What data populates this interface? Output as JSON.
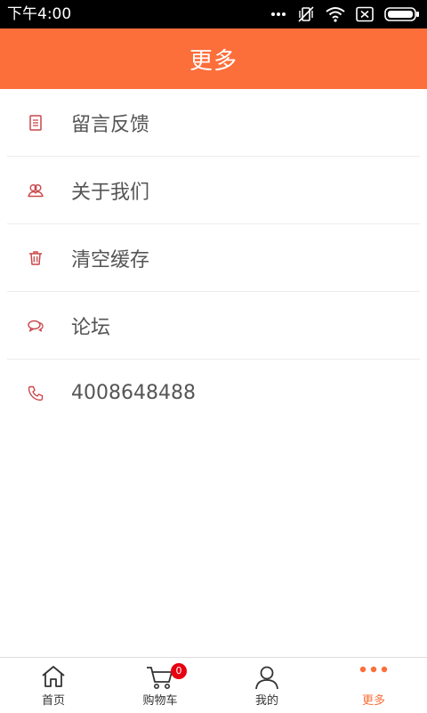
{
  "status_bar": {
    "time": "下午4:00",
    "icons": [
      "more-dots-icon",
      "vibrate-off-icon",
      "wifi-icon",
      "sim-off-icon",
      "battery-icon"
    ]
  },
  "header": {
    "title": "更多",
    "color": "#fc6e3a"
  },
  "menu": {
    "items": [
      {
        "label": "留言反馈",
        "icon": "feedback-document-icon"
      },
      {
        "label": "关于我们",
        "icon": "about-users-icon"
      },
      {
        "label": "清空缓存",
        "icon": "trash-icon"
      },
      {
        "label": "论坛",
        "icon": "chat-bubbles-icon"
      },
      {
        "label": "4008648488",
        "icon": "phone-icon"
      }
    ],
    "icon_color": "#c9464b"
  },
  "tab_bar": {
    "tabs": [
      {
        "label": "首页",
        "icon": "home-icon",
        "active": false
      },
      {
        "label": "购物车",
        "icon": "cart-icon",
        "active": false,
        "badge": "0"
      },
      {
        "label": "我的",
        "icon": "user-icon",
        "active": false
      },
      {
        "label": "更多",
        "icon": "more-dots-icon",
        "active": true
      }
    ],
    "active_color": "#fc6e3a",
    "badge_color": "#e60012"
  }
}
